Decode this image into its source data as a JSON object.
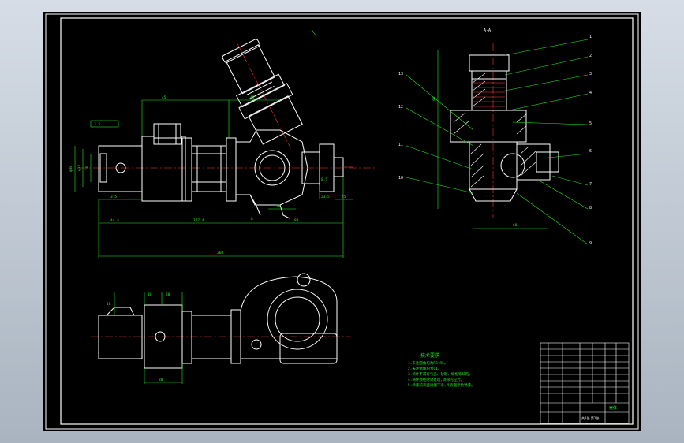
{
  "drawing": {
    "section_label": "A-A",
    "balloons": [
      "1",
      "2",
      "3",
      "4",
      "5",
      "6",
      "7",
      "8",
      "9",
      "10",
      "11",
      "12",
      "13"
    ],
    "front_view_dims": {
      "top_a": "45",
      "top_b": "45",
      "left_a": "φ40",
      "left_b": "φ32",
      "left_c": "36",
      "small_a": "3.5",
      "small_b": "3.5",
      "bottom_a": "44.4",
      "bottom_b": "127.4",
      "bottom_c": "88",
      "overall": "260",
      "right_a": "8.5",
      "right_b": "23.5",
      "right_c": "45",
      "mid_a": "8",
      "mid_b": "30"
    },
    "section_dims": {
      "height": "90",
      "width": "60"
    },
    "top_view_dims": {
      "a": "18",
      "b": "20",
      "c": "18",
      "d": "30"
    },
    "notes_title": "技术要求",
    "notes": [
      "1.未注圆角均为R3~R5。",
      "2.未注倒角均为C1。",
      "3.铸件不得有气孔、砂眼、缩松等缺陷。",
      "4.铸件须经时效处理,消除内应力。",
      "5.涂漆前表面清理干净,外表面涂防锈漆。"
    ],
    "title_block": {
      "part_name": "壳体",
      "sheet": "共1张 第1张"
    }
  },
  "colors": {
    "sheet": "#000000",
    "line": "#ffffff",
    "dimension": "#22ee22",
    "center": "#ff3333",
    "leader": "#22ee22"
  }
}
